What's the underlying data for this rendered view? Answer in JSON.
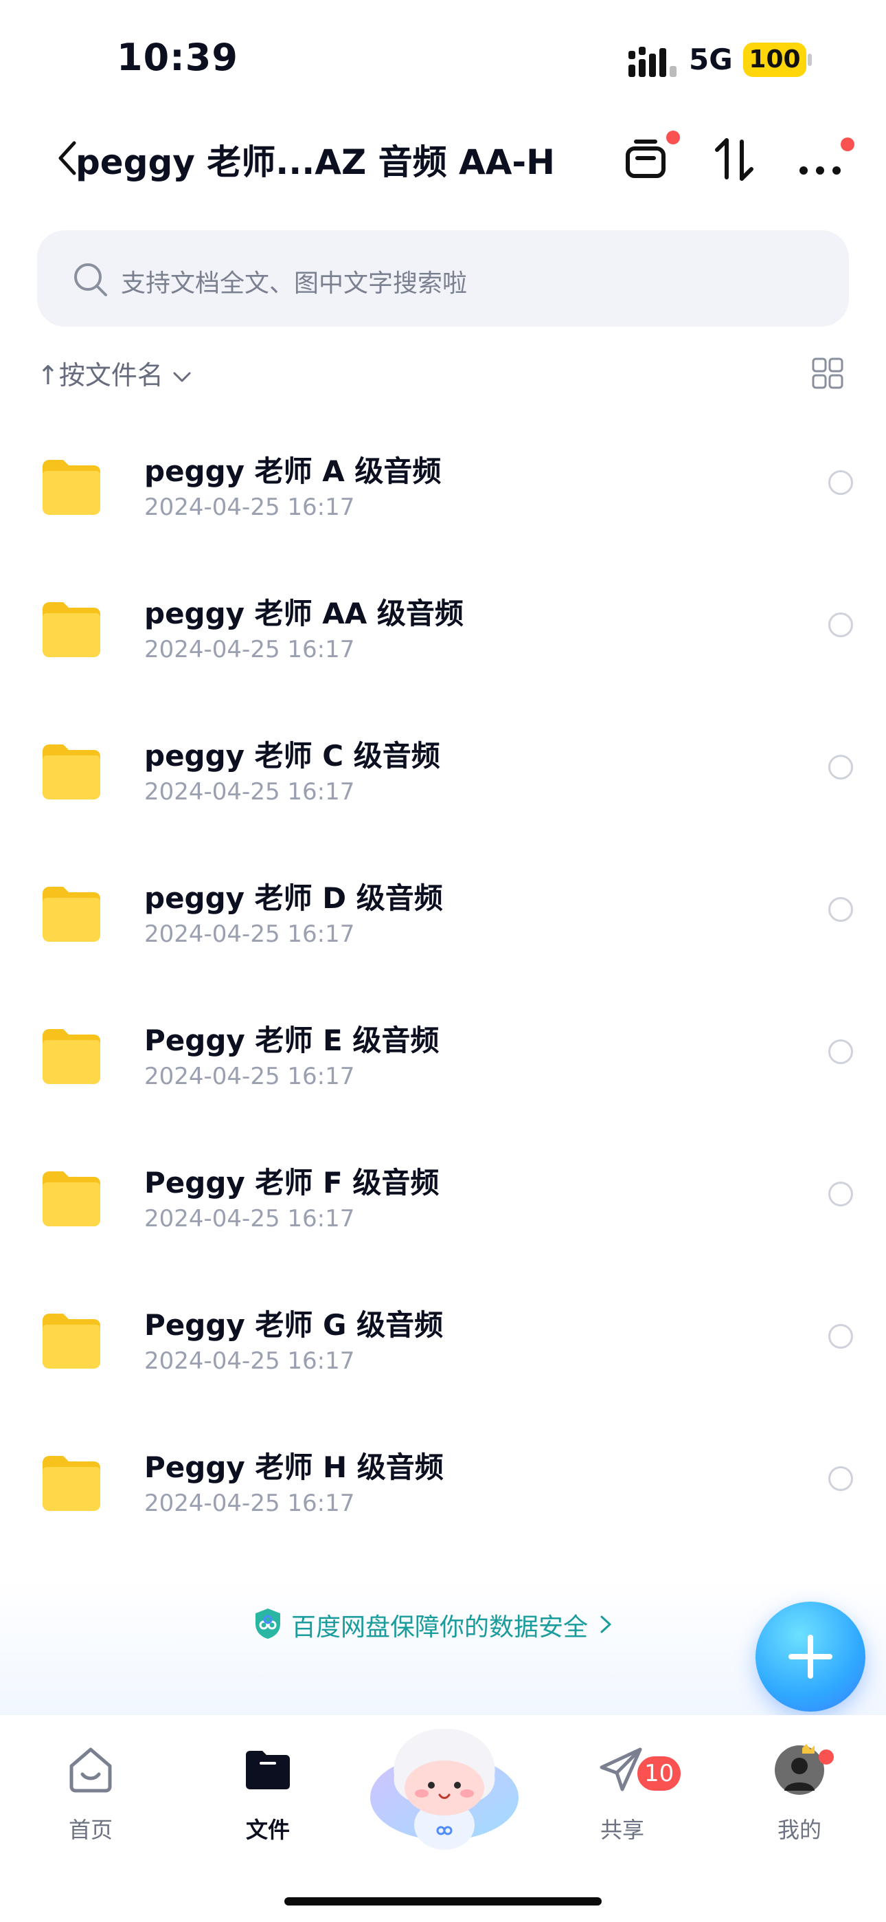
{
  "status_bar": {
    "time": "10:39",
    "network": "5G",
    "battery": "100"
  },
  "nav": {
    "title": "peggy 老师...AZ 音频 AA-H",
    "has_notification_dot": true
  },
  "search": {
    "placeholder": "支持文档全文、图中文字搜索啦"
  },
  "sort": {
    "label": "按文件名"
  },
  "files": [
    {
      "name": "peggy 老师 A 级音频",
      "date": "2024-04-25 16:17"
    },
    {
      "name": "peggy 老师 AA 级音频",
      "date": "2024-04-25 16:17"
    },
    {
      "name": "peggy 老师 C 级音频",
      "date": "2024-04-25 16:17"
    },
    {
      "name": "peggy 老师 D 级音频",
      "date": "2024-04-25 16:17"
    },
    {
      "name": "Peggy 老师 E 级音频",
      "date": "2024-04-25 16:17"
    },
    {
      "name": "Peggy 老师 F 级音频",
      "date": "2024-04-25 16:17"
    },
    {
      "name": "Peggy 老师 G 级音频",
      "date": "2024-04-25 16:17"
    },
    {
      "name": "Peggy 老师 H 级音频",
      "date": "2024-04-25 16:17"
    }
  ],
  "security_banner": {
    "text": "百度网盘保障你的数据安全"
  },
  "tabbar": {
    "tabs": [
      {
        "label": "首页",
        "icon": "home-icon",
        "active": false
      },
      {
        "label": "文件",
        "icon": "folder-icon",
        "active": true
      },
      {
        "label": "共享",
        "icon": "paper-plane-icon",
        "active": false,
        "badge": "10"
      },
      {
        "label": "我的",
        "icon": "avatar-icon",
        "active": false
      }
    ]
  },
  "colors": {
    "accent": "#2fa9ff",
    "folder": "#ffd33a",
    "badge": "#fa5151",
    "security_text": "#1a9c9c"
  }
}
